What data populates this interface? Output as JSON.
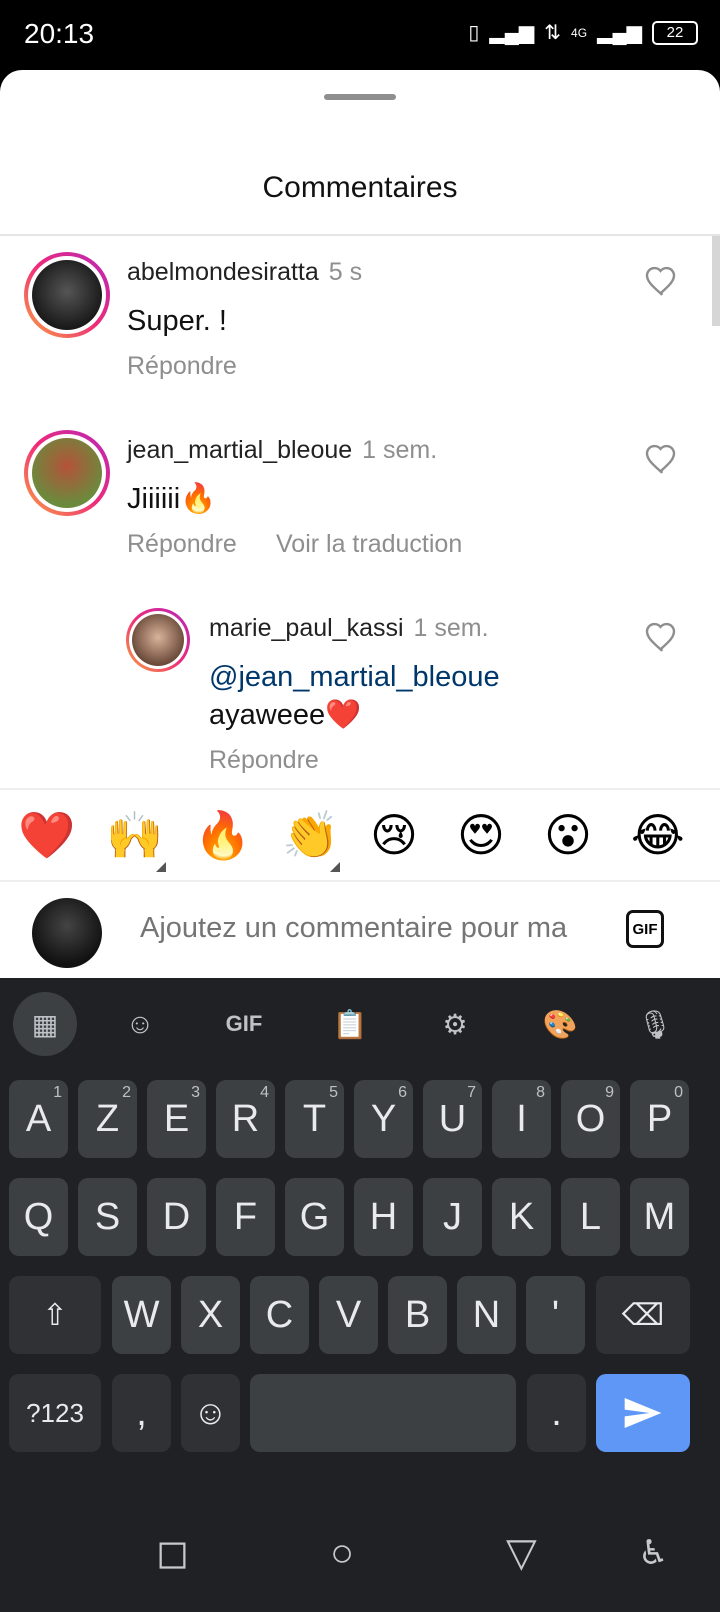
{
  "status": {
    "time": "20:13",
    "battery": "22",
    "network": "4G"
  },
  "sheet": {
    "title": "Commentaires"
  },
  "comments": [
    {
      "username": "abelmondesiratta",
      "time": "5 s",
      "text": "Super. !",
      "reply_label": "Répondre"
    },
    {
      "username": "jean_martial_bleoue",
      "time": "1 sem.",
      "text": "Jiiiiii🔥",
      "reply_label": "Répondre",
      "translate_label": "Voir la traduction"
    },
    {
      "username": "marie_paul_kassi",
      "time": "1 sem.",
      "mention": "@jean_martial_bleoue",
      "text": "ayaweee❤️",
      "reply_label": "Répondre"
    }
  ],
  "emoji_bar": [
    "❤️",
    "🙌",
    "🔥",
    "👏",
    "😢",
    "😍",
    "😮",
    "😂"
  ],
  "input": {
    "placeholder": "Ajoutez un commentaire pour ma",
    "gif_label": "GIF"
  },
  "keyboard": {
    "toolbar": {
      "gif_label": "GIF"
    },
    "row1": [
      {
        "k": "A",
        "h": "1"
      },
      {
        "k": "Z",
        "h": "2"
      },
      {
        "k": "E",
        "h": "3"
      },
      {
        "k": "R",
        "h": "4"
      },
      {
        "k": "T",
        "h": "5"
      },
      {
        "k": "Y",
        "h": "6"
      },
      {
        "k": "U",
        "h": "7"
      },
      {
        "k": "I",
        "h": "8"
      },
      {
        "k": "O",
        "h": "9"
      },
      {
        "k": "P",
        "h": "0"
      }
    ],
    "row2": [
      "Q",
      "S",
      "D",
      "F",
      "G",
      "H",
      "J",
      "K",
      "L",
      "M"
    ],
    "row3": [
      "W",
      "X",
      "C",
      "V",
      "B",
      "N",
      "'"
    ],
    "symbols_label": "?123",
    "comma": ",",
    "period": "."
  }
}
